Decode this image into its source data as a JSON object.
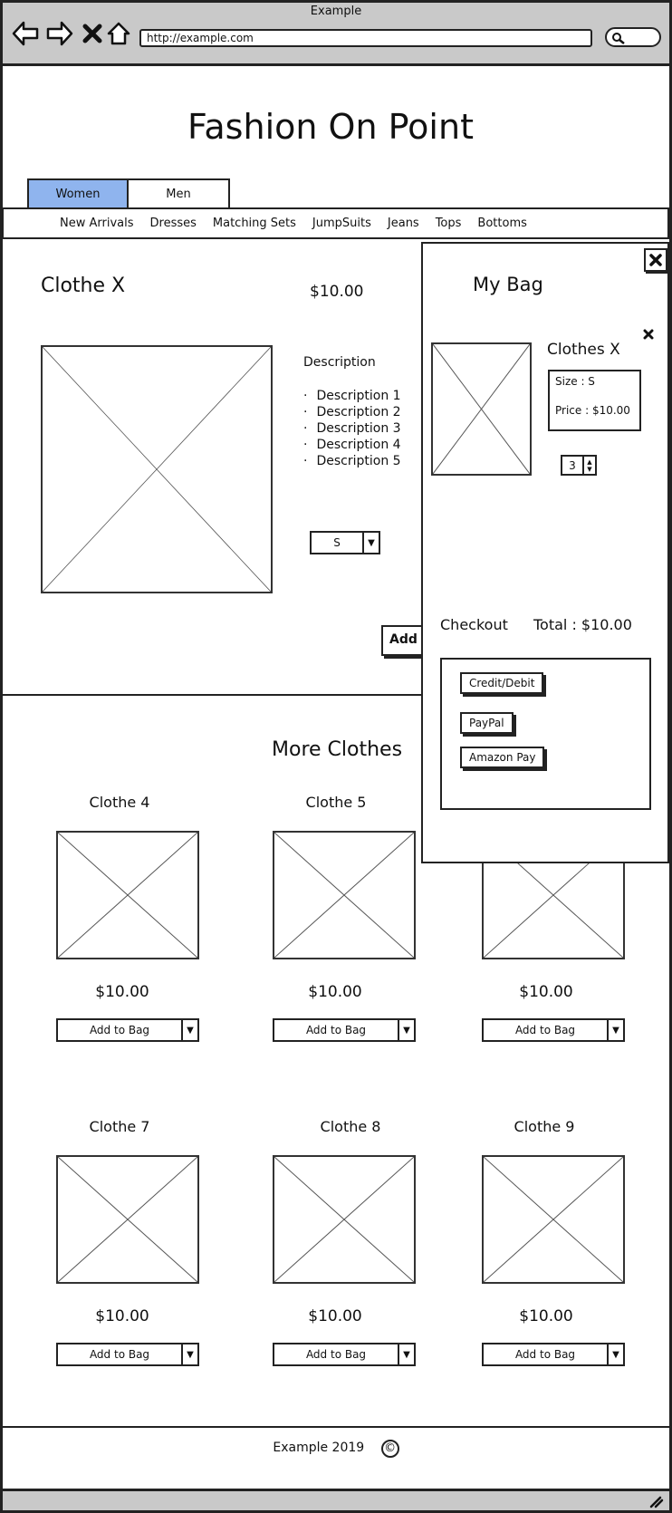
{
  "browser": {
    "window_title": "Example",
    "url": "http://example.com"
  },
  "site": {
    "title": "Fashion On Point",
    "gender_tabs": [
      "Women",
      "Men"
    ],
    "categories": [
      "New Arrivals",
      "Dresses",
      "Matching Sets",
      "JumpSuits",
      "Jeans",
      "Tops",
      "Bottoms"
    ]
  },
  "product": {
    "name": "Clothe X",
    "price": "$10.00",
    "description_heading": "Description",
    "descriptions": [
      "Description 1",
      "Description 2",
      "Description 3",
      "Description 4",
      "Description 5"
    ],
    "size_value": "S",
    "add_button_label": "Add to Bag"
  },
  "more": {
    "title": "More Clothes",
    "items": [
      {
        "name": "Clothe 4",
        "price": "$10.00",
        "button": "Add to Bag"
      },
      {
        "name": "Clothe 5",
        "price": "$10.00",
        "button": "Add to Bag"
      },
      {
        "name": "",
        "price": "$10.00",
        "button": "Add to Bag"
      },
      {
        "name": "Clothe 7",
        "price": "$10.00",
        "button": "Add to Bag"
      },
      {
        "name": "Clothe 8",
        "price": "$10.00",
        "button": "Add to Bag"
      },
      {
        "name": "Clothe 9",
        "price": "$10.00",
        "button": "Add to Bag"
      }
    ]
  },
  "bag": {
    "title": "My Bag",
    "item_name": "Clothes X",
    "size_line": "Size :  S",
    "price_line": "Price : $10.00",
    "quantity": "3",
    "checkout_label": "Checkout",
    "total_label": "Total : $10.00",
    "payments": [
      "Credit/Debit",
      "PayPal",
      "Amazon Pay"
    ]
  },
  "footer": {
    "text": "Example 2019",
    "copyright_symbol": "©"
  },
  "colors": {
    "active_tab": "#8fb4ee",
    "chrome": "#c9c9c9"
  }
}
